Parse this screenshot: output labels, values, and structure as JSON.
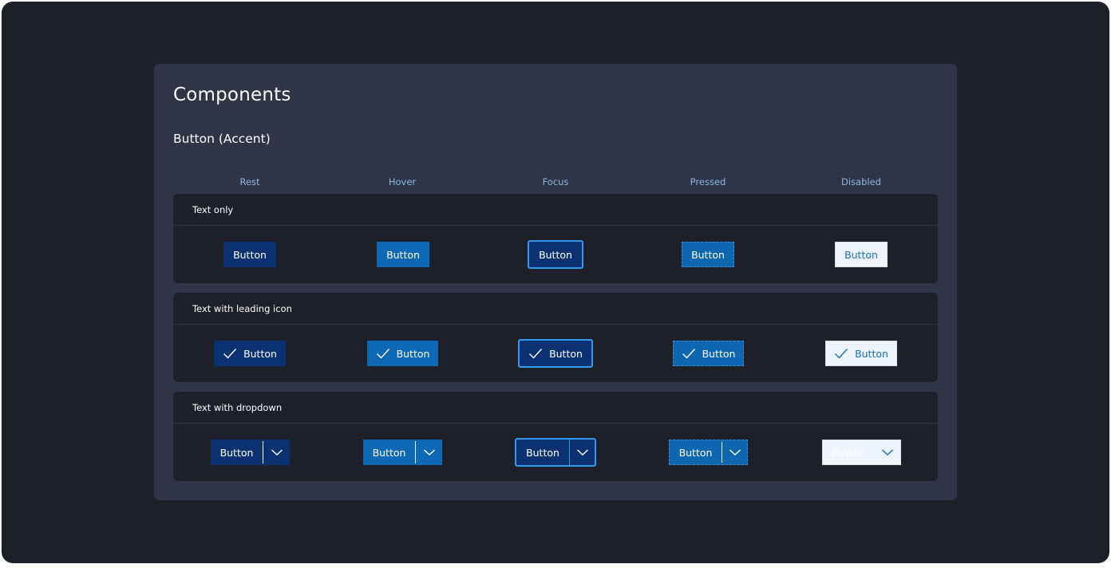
{
  "page": {
    "title": "Components"
  },
  "section": {
    "title": "Button (Accent)"
  },
  "states": [
    "Rest",
    "Hover",
    "Focus",
    "Pressed",
    "Disabled"
  ],
  "rows": [
    {
      "title": "Text only"
    },
    {
      "title": "Text with leading icon"
    },
    {
      "title": "Text with dropdown"
    }
  ],
  "button": {
    "label": "Button",
    "icon": "checkmark-icon",
    "dropdown_icon": "chevron-down-icon"
  },
  "colors": {
    "background": "#1e2029",
    "panel": "#2f3447",
    "accent_rest": "#0a3272",
    "accent_hover": "#0d69b5",
    "focus_ring": "#2e9bf0",
    "disabled_bg": "#eef4fb",
    "disabled_text": "#1a6fb5",
    "state_label": "#8fb8dd"
  }
}
